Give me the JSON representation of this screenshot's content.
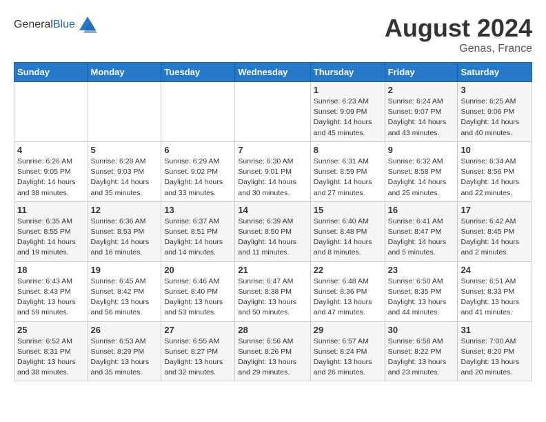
{
  "header": {
    "logo_general": "General",
    "logo_blue": "Blue",
    "month": "August 2024",
    "location": "Genas, France"
  },
  "weekdays": [
    "Sunday",
    "Monday",
    "Tuesday",
    "Wednesday",
    "Thursday",
    "Friday",
    "Saturday"
  ],
  "weeks": [
    [
      {
        "day": "",
        "info": ""
      },
      {
        "day": "",
        "info": ""
      },
      {
        "day": "",
        "info": ""
      },
      {
        "day": "",
        "info": ""
      },
      {
        "day": "1",
        "info": "Sunrise: 6:23 AM\nSunset: 9:09 PM\nDaylight: 14 hours and 45 minutes."
      },
      {
        "day": "2",
        "info": "Sunrise: 6:24 AM\nSunset: 9:07 PM\nDaylight: 14 hours and 43 minutes."
      },
      {
        "day": "3",
        "info": "Sunrise: 6:25 AM\nSunset: 9:06 PM\nDaylight: 14 hours and 40 minutes."
      }
    ],
    [
      {
        "day": "4",
        "info": "Sunrise: 6:26 AM\nSunset: 9:05 PM\nDaylight: 14 hours and 38 minutes."
      },
      {
        "day": "5",
        "info": "Sunrise: 6:28 AM\nSunset: 9:03 PM\nDaylight: 14 hours and 35 minutes."
      },
      {
        "day": "6",
        "info": "Sunrise: 6:29 AM\nSunset: 9:02 PM\nDaylight: 14 hours and 33 minutes."
      },
      {
        "day": "7",
        "info": "Sunrise: 6:30 AM\nSunset: 9:01 PM\nDaylight: 14 hours and 30 minutes."
      },
      {
        "day": "8",
        "info": "Sunrise: 6:31 AM\nSunset: 8:59 PM\nDaylight: 14 hours and 27 minutes."
      },
      {
        "day": "9",
        "info": "Sunrise: 6:32 AM\nSunset: 8:58 PM\nDaylight: 14 hours and 25 minutes."
      },
      {
        "day": "10",
        "info": "Sunrise: 6:34 AM\nSunset: 8:56 PM\nDaylight: 14 hours and 22 minutes."
      }
    ],
    [
      {
        "day": "11",
        "info": "Sunrise: 6:35 AM\nSunset: 8:55 PM\nDaylight: 14 hours and 19 minutes."
      },
      {
        "day": "12",
        "info": "Sunrise: 6:36 AM\nSunset: 8:53 PM\nDaylight: 14 hours and 16 minutes."
      },
      {
        "day": "13",
        "info": "Sunrise: 6:37 AM\nSunset: 8:51 PM\nDaylight: 14 hours and 14 minutes."
      },
      {
        "day": "14",
        "info": "Sunrise: 6:39 AM\nSunset: 8:50 PM\nDaylight: 14 hours and 11 minutes."
      },
      {
        "day": "15",
        "info": "Sunrise: 6:40 AM\nSunset: 8:48 PM\nDaylight: 14 hours and 8 minutes."
      },
      {
        "day": "16",
        "info": "Sunrise: 6:41 AM\nSunset: 8:47 PM\nDaylight: 14 hours and 5 minutes."
      },
      {
        "day": "17",
        "info": "Sunrise: 6:42 AM\nSunset: 8:45 PM\nDaylight: 14 hours and 2 minutes."
      }
    ],
    [
      {
        "day": "18",
        "info": "Sunrise: 6:43 AM\nSunset: 8:43 PM\nDaylight: 13 hours and 59 minutes."
      },
      {
        "day": "19",
        "info": "Sunrise: 6:45 AM\nSunset: 8:42 PM\nDaylight: 13 hours and 56 minutes."
      },
      {
        "day": "20",
        "info": "Sunrise: 6:46 AM\nSunset: 8:40 PM\nDaylight: 13 hours and 53 minutes."
      },
      {
        "day": "21",
        "info": "Sunrise: 6:47 AM\nSunset: 8:38 PM\nDaylight: 13 hours and 50 minutes."
      },
      {
        "day": "22",
        "info": "Sunrise: 6:48 AM\nSunset: 8:36 PM\nDaylight: 13 hours and 47 minutes."
      },
      {
        "day": "23",
        "info": "Sunrise: 6:50 AM\nSunset: 8:35 PM\nDaylight: 13 hours and 44 minutes."
      },
      {
        "day": "24",
        "info": "Sunrise: 6:51 AM\nSunset: 8:33 PM\nDaylight: 13 hours and 41 minutes."
      }
    ],
    [
      {
        "day": "25",
        "info": "Sunrise: 6:52 AM\nSunset: 8:31 PM\nDaylight: 13 hours and 38 minutes."
      },
      {
        "day": "26",
        "info": "Sunrise: 6:53 AM\nSunset: 8:29 PM\nDaylight: 13 hours and 35 minutes."
      },
      {
        "day": "27",
        "info": "Sunrise: 6:55 AM\nSunset: 8:27 PM\nDaylight: 13 hours and 32 minutes."
      },
      {
        "day": "28",
        "info": "Sunrise: 6:56 AM\nSunset: 8:26 PM\nDaylight: 13 hours and 29 minutes."
      },
      {
        "day": "29",
        "info": "Sunrise: 6:57 AM\nSunset: 8:24 PM\nDaylight: 13 hours and 26 minutes."
      },
      {
        "day": "30",
        "info": "Sunrise: 6:58 AM\nSunset: 8:22 PM\nDaylight: 13 hours and 23 minutes."
      },
      {
        "day": "31",
        "info": "Sunrise: 7:00 AM\nSunset: 8:20 PM\nDaylight: 13 hours and 20 minutes."
      }
    ]
  ]
}
